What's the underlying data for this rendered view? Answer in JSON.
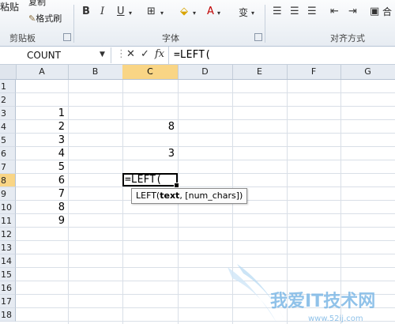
{
  "ribbon": {
    "paste_label": "粘贴",
    "copy_label": "复制",
    "format_painter_label": "格式刷",
    "clipboard_group": "剪贴板",
    "font_group": "字体",
    "alignment_group": "对齐方式",
    "merge_label": "合",
    "bold": "B",
    "italic": "I",
    "underline": "U",
    "font_color_a": "A",
    "wen": "变"
  },
  "formula_bar": {
    "name_box": "COUNT",
    "cancel": "✕",
    "enter": "✓",
    "fx": "fx",
    "formula": "=LEFT("
  },
  "columns": [
    "A",
    "B",
    "C",
    "D",
    "E",
    "F",
    "G"
  ],
  "active_column": "C",
  "rows": [
    "1",
    "2",
    "3",
    "4",
    "5",
    "6",
    "7",
    "8",
    "9",
    "10",
    "11",
    "12",
    "13",
    "14",
    "15",
    "16",
    "17",
    "18"
  ],
  "active_row": "8",
  "cells": {
    "a3": "1",
    "a4": "2",
    "a5": "3",
    "a6": "4",
    "a7": "5",
    "a8": "6",
    "a9": "7",
    "a10": "8",
    "a11": "9",
    "c4": "8",
    "c6": "3"
  },
  "editing_text": "=LEFT(",
  "tooltip": {
    "func": "LEFT(",
    "arg1": "text",
    "rest": ", [num_chars])"
  },
  "watermark": {
    "text": "我爱IT技术网",
    "url": "www.52ij.com"
  },
  "colors": {
    "active_header": "#f9d585",
    "header_bg": "#e6ebf2",
    "grid_line": "#d9dfe7"
  }
}
